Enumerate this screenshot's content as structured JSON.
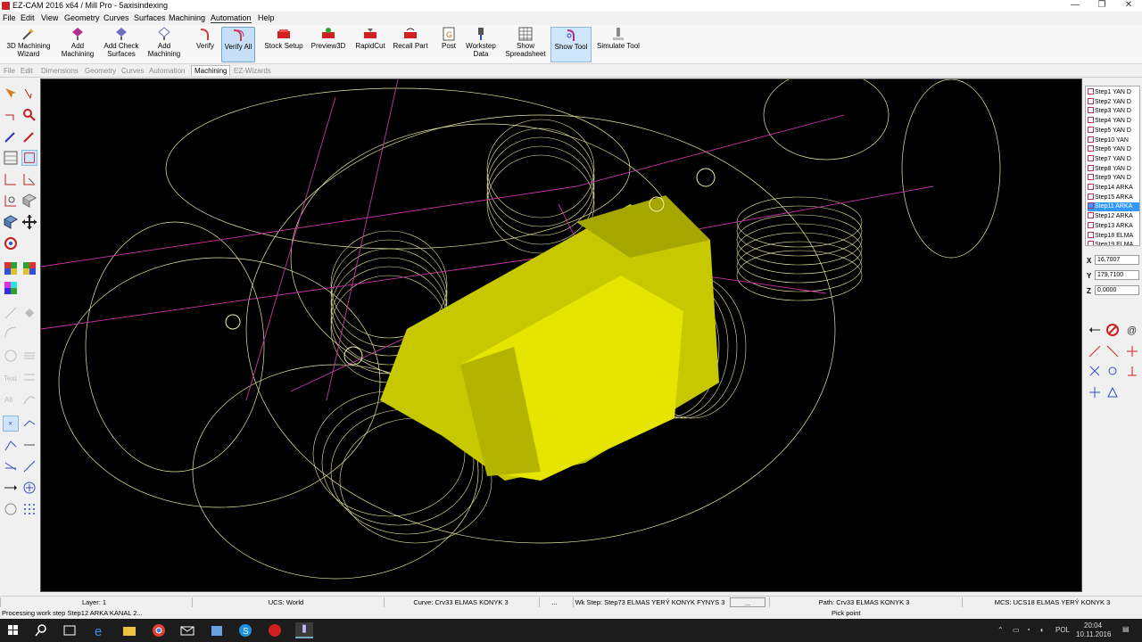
{
  "window": {
    "title": "EZ-CAM 2016 x64 / Mill Pro - 5axisindexing",
    "minimize": "—",
    "restore": "❐",
    "close": "✕"
  },
  "menu": [
    "File",
    "Edit",
    "View",
    "Geometry",
    "Curves",
    "Surfaces",
    "Machining",
    "Automation",
    "Help"
  ],
  "ribbon": [
    {
      "l1": "3D Machining",
      "l2": "Wizard",
      "icon": "wizard-icon"
    },
    {
      "l1": "Add",
      "l2": "Machining",
      "icon": "add-machining-icon"
    },
    {
      "l1": "Add Check",
      "l2": "Surfaces",
      "icon": "check-surfaces-icon"
    },
    {
      "l1": "Add",
      "l2": "Machining",
      "icon": "add-machining-2-icon"
    },
    {
      "l1": "Verify",
      "l2": "",
      "icon": "verify-icon"
    },
    {
      "l1": "Verify All",
      "l2": "",
      "icon": "verify-all-icon"
    },
    {
      "l1": "Stock Setup",
      "l2": "",
      "icon": "stock-setup-icon"
    },
    {
      "l1": "Preview3D",
      "l2": "",
      "icon": "preview3d-icon"
    },
    {
      "l1": "RapidCut",
      "l2": "",
      "icon": "rapidcut-icon"
    },
    {
      "l1": "Recall Part",
      "l2": "",
      "icon": "recall-part-icon"
    },
    {
      "l1": "Post",
      "l2": "",
      "icon": "post-icon"
    },
    {
      "l1": "Workstep",
      "l2": "Data",
      "icon": "workstep-data-icon"
    },
    {
      "l1": "Show",
      "l2": "Spreadsheet",
      "icon": "spreadsheet-icon"
    },
    {
      "l1": "Show Tool",
      "l2": "",
      "icon": "show-tool-icon"
    },
    {
      "l1": "Simulate Tool",
      "l2": "",
      "icon": "simulate-tool-icon"
    }
  ],
  "tabs": [
    "File",
    "Edit",
    "Dimensions",
    "Geometry",
    "Curves",
    "Automation",
    "Machining",
    "EZ-Wizards"
  ],
  "active_tab": "Machining",
  "steps": [
    "Step1 YAN D",
    "Step2 YAN D",
    "Step3 YAN D",
    "Step4 YAN D",
    "Step5 YAN D",
    "Step10 YAN",
    "Step6 YAN D",
    "Step7 YAN D",
    "Step8 YAN D",
    "Step9 YAN D",
    "Step14 ARKA",
    "Step15 ARKA",
    "Step11 ARKA",
    "Step12 ARKA",
    "Step13 ARKA",
    "Step18 ELMA",
    "Step19 ELMA"
  ],
  "selected_step_index": 12,
  "coords": {
    "x_label": "X",
    "x": "16,7007",
    "y_label": "Y",
    "y": "179,7100",
    "z_label": "Z",
    "z": "0,0000"
  },
  "status": {
    "layer": "Layer: 1",
    "ucs": "UCS: World",
    "curve": "Curve: Crv33 ELMAS  KONYK 3",
    "dots1": "...",
    "wkstep": "Wk Step: Step73 ELMAS YERÝ KONYK FYNYS 3",
    "dots2": "...",
    "path": "Path: Crv33 ELMAS  KONYK 3",
    "mcs": "MCS: UCS18 ELMAS YERÝ KONYK 3"
  },
  "message": "Processing work step Step12 ARKA KANAL 2...",
  "hint": "Pick point",
  "taskbar": {
    "lang": "POL",
    "time": "20:04",
    "date": "10.11.2016"
  },
  "colors": {
    "viewport_bg": "#000000",
    "wireframe": "#e8e8a0",
    "toolpath": "#cc33aa",
    "solid": "#d8d800",
    "selection": "#3399ff"
  }
}
